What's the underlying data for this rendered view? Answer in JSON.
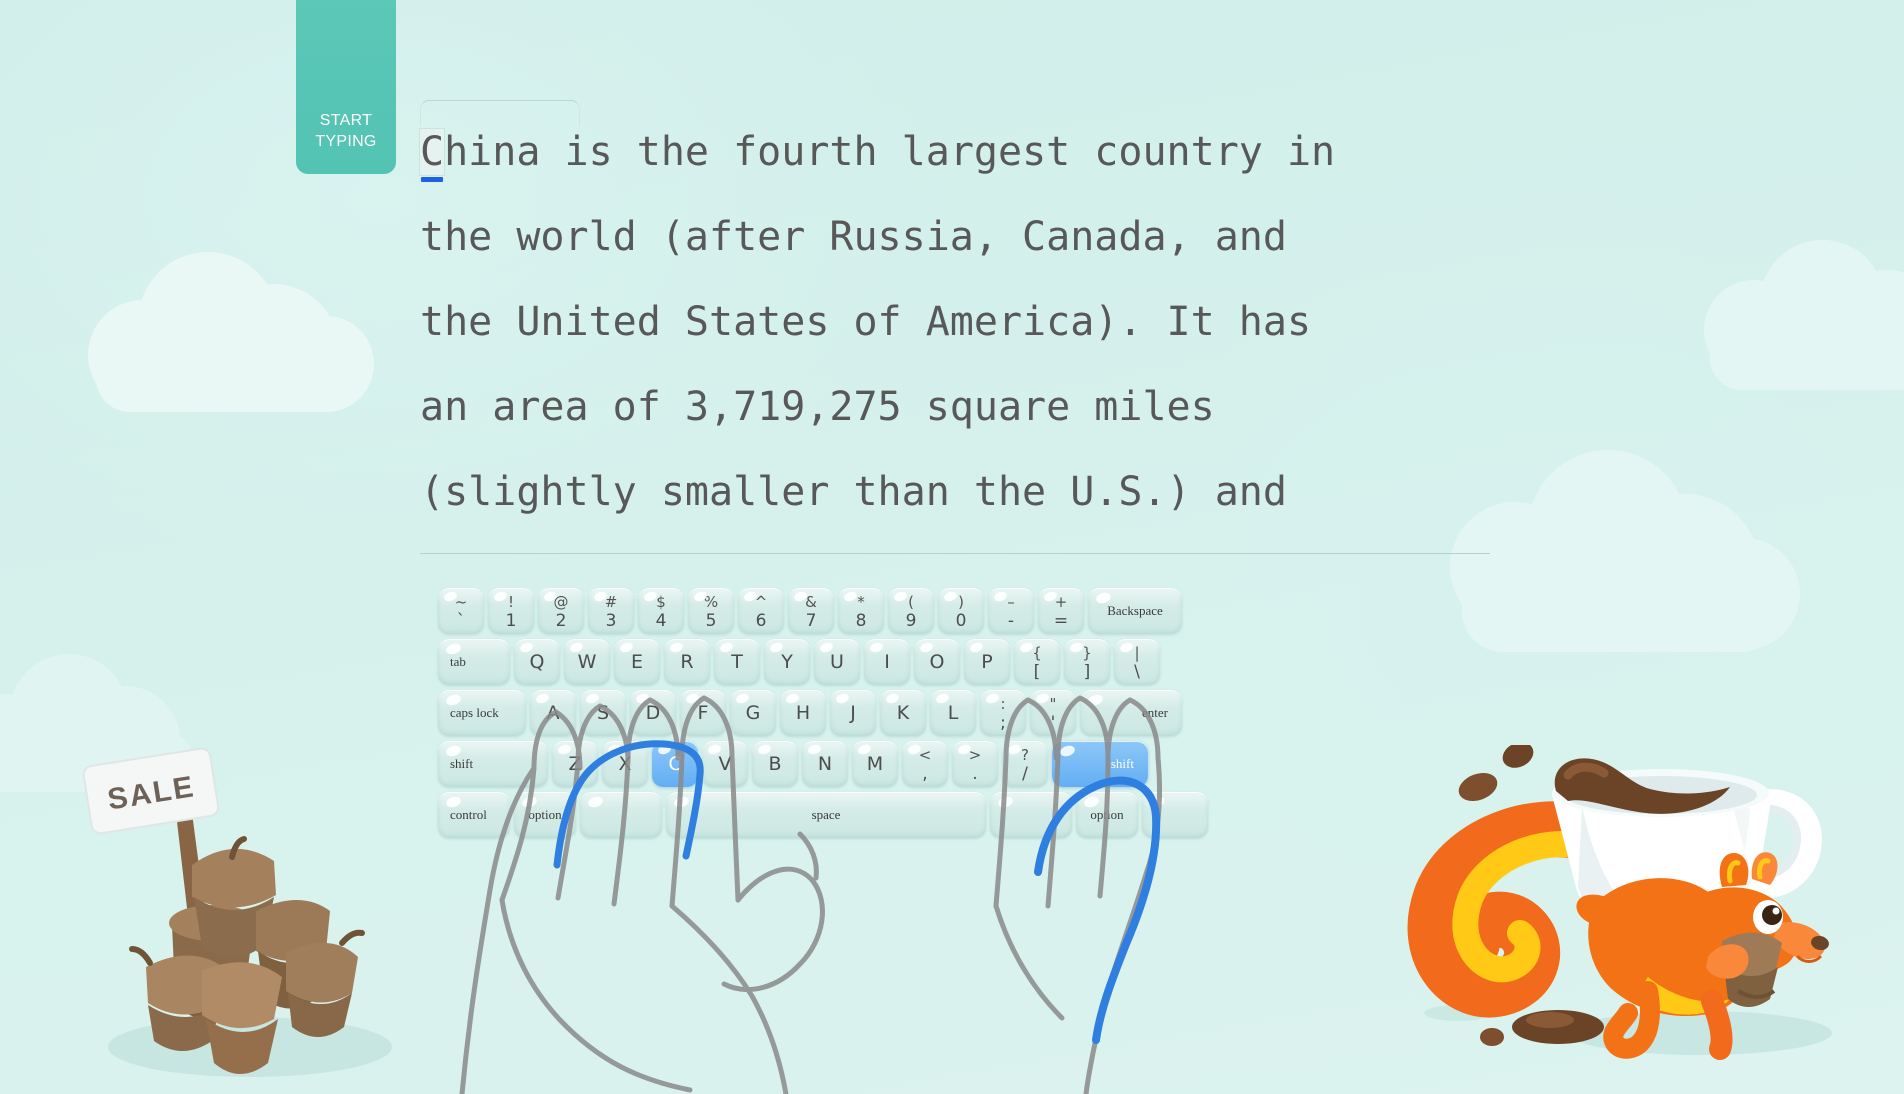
{
  "app": {
    "background_color": "#d2f0ec",
    "accent_color": "#5cc8b8",
    "key_color": "#cfe9e4",
    "active_key_color": "#63aef4",
    "cursor_color": "#1b62e8",
    "text_color": "#585858"
  },
  "start_tab": {
    "line1": "START",
    "line2": "TYPING"
  },
  "typing_text": {
    "first_char": "C",
    "first_line_rest": "hina is the fourth largest country in",
    "lines": [
      "the world (after Russia, Canada, and",
      "the United States of America). It has",
      "an area of 3,719,275 square miles",
      "(slightly smaller than the U.S.) and"
    ],
    "full_text": "China is the fourth largest country in the world (after Russia, Canada, and the United States of America). It has an area of 3,719,275 square miles (slightly smaller than the U.S.) and"
  },
  "keyboard": {
    "active_keys": [
      "C",
      "shift-right"
    ],
    "rows": [
      {
        "name": "number-row",
        "keys": [
          {
            "id": "backtick",
            "upper": "~",
            "lower": "`"
          },
          {
            "id": "1",
            "upper": "!",
            "lower": "1"
          },
          {
            "id": "2",
            "upper": "@",
            "lower": "2"
          },
          {
            "id": "3",
            "upper": "#",
            "lower": "3"
          },
          {
            "id": "4",
            "upper": "$",
            "lower": "4"
          },
          {
            "id": "5",
            "upper": "%",
            "lower": "5"
          },
          {
            "id": "6",
            "upper": "^",
            "lower": "6"
          },
          {
            "id": "7",
            "upper": "&",
            "lower": "7"
          },
          {
            "id": "8",
            "upper": "*",
            "lower": "8"
          },
          {
            "id": "9",
            "upper": "(",
            "lower": "9"
          },
          {
            "id": "0",
            "upper": ")",
            "lower": "0"
          },
          {
            "id": "minus",
            "upper": "–",
            "lower": "-"
          },
          {
            "id": "equals",
            "upper": "+",
            "lower": "="
          },
          {
            "id": "backspace",
            "label": "Backspace",
            "mod": true,
            "width": "w-backspace",
            "align": "center"
          }
        ]
      },
      {
        "name": "top-row",
        "keys": [
          {
            "id": "tab",
            "label": "tab",
            "mod": true,
            "width": "w-tab",
            "align": "left"
          },
          {
            "id": "Q",
            "label": "Q"
          },
          {
            "id": "W",
            "label": "W"
          },
          {
            "id": "E",
            "label": "E"
          },
          {
            "id": "R",
            "label": "R"
          },
          {
            "id": "T",
            "label": "T"
          },
          {
            "id": "Y",
            "label": "Y"
          },
          {
            "id": "U",
            "label": "U"
          },
          {
            "id": "I",
            "label": "I"
          },
          {
            "id": "O",
            "label": "O"
          },
          {
            "id": "P",
            "label": "P"
          },
          {
            "id": "bracketleft",
            "upper": "{",
            "lower": "["
          },
          {
            "id": "bracketright",
            "upper": "}",
            "lower": "]"
          },
          {
            "id": "backslash",
            "upper": "|",
            "lower": "\\"
          }
        ]
      },
      {
        "name": "home-row",
        "keys": [
          {
            "id": "capslock",
            "label": "caps lock",
            "mod": true,
            "width": "w-capslock",
            "align": "left"
          },
          {
            "id": "A",
            "label": "A"
          },
          {
            "id": "S",
            "label": "S"
          },
          {
            "id": "D",
            "label": "D"
          },
          {
            "id": "F",
            "label": "F"
          },
          {
            "id": "G",
            "label": "G"
          },
          {
            "id": "H",
            "label": "H"
          },
          {
            "id": "J",
            "label": "J"
          },
          {
            "id": "K",
            "label": "K"
          },
          {
            "id": "L",
            "label": "L"
          },
          {
            "id": "semicolon",
            "upper": ":",
            "lower": ";"
          },
          {
            "id": "quote",
            "upper": "\"",
            "lower": "'"
          },
          {
            "id": "enter",
            "label": "enter",
            "mod": true,
            "width": "w-enter",
            "align": "right"
          }
        ]
      },
      {
        "name": "bottom-letter-row",
        "keys": [
          {
            "id": "shift-left",
            "label": "shift",
            "mod": true,
            "width": "w-shiftL",
            "align": "left"
          },
          {
            "id": "Z",
            "label": "Z"
          },
          {
            "id": "X",
            "label": "X"
          },
          {
            "id": "C",
            "label": "C",
            "active": true
          },
          {
            "id": "V",
            "label": "V"
          },
          {
            "id": "B",
            "label": "B"
          },
          {
            "id": "N",
            "label": "N"
          },
          {
            "id": "M",
            "label": "M"
          },
          {
            "id": "comma",
            "upper": "<",
            "lower": ","
          },
          {
            "id": "period",
            "upper": ">",
            "lower": "."
          },
          {
            "id": "slash",
            "upper": "?",
            "lower": "/"
          },
          {
            "id": "shift-right",
            "label": "shift",
            "mod": true,
            "width": "w-shiftR",
            "align": "right",
            "active": true
          }
        ]
      },
      {
        "name": "modifier-row",
        "keys": [
          {
            "id": "control",
            "label": "control",
            "mod": true,
            "width": "w-control",
            "align": "left"
          },
          {
            "id": "option-left",
            "label": "option",
            "mod": true,
            "width": "w-option",
            "align": "center"
          },
          {
            "id": "command-left",
            "label": "",
            "mod": true,
            "width": "w-cmdblank",
            "align": "center"
          },
          {
            "id": "space",
            "label": "space",
            "mod": true,
            "width": "w-space",
            "align": "center"
          },
          {
            "id": "command-right",
            "label": "",
            "mod": true,
            "width": "w-cmdblank",
            "align": "center"
          },
          {
            "id": "option-right",
            "label": "option",
            "mod": true,
            "width": "w-option",
            "align": "center"
          },
          {
            "id": "bottom-end",
            "label": "",
            "mod": true,
            "width": "w-bottomend",
            "align": "center"
          }
        ]
      }
    ]
  },
  "decorations": {
    "sale_sign_text": "SALE",
    "acorn_pile": "acorn-pile-illustration",
    "squirrel": "squirrel-with-coffee-cup-illustration",
    "clouds": "background-clouds"
  }
}
